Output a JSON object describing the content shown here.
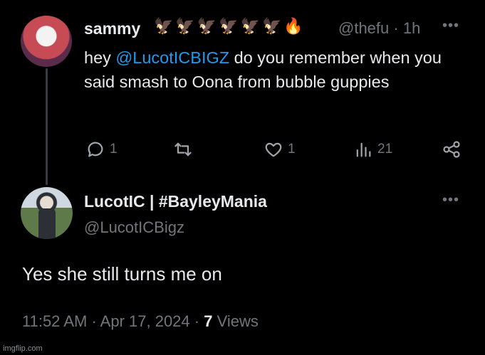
{
  "tweet1": {
    "author_name": "sammy",
    "badge_emojis": "🦅🦅🦅🦅🦅🦅🔥",
    "handle": "@thefu",
    "time": "1h",
    "more_label": "•••",
    "text_before": "hey ",
    "mention": "@LucotICBIGZ",
    "text_after": " do you remember when you said smash to Oona from bubble guppies",
    "reply_count": "1",
    "repost_count": "",
    "like_count": "1",
    "views_count": "21"
  },
  "tweet2": {
    "author_name": "LucotIC | #BayleyMania",
    "handle": "@LucotICBigz",
    "more_label": "•••",
    "text": "Yes she still turns me on",
    "time": "11:52 AM",
    "date": "Apr 17, 2024",
    "views_count": "7",
    "views_label": "Views"
  },
  "icons": {
    "reply": "comment-icon",
    "repost": "repost-icon",
    "like": "heart-icon",
    "views": "analytics-icon",
    "share": "share-icon"
  },
  "watermark": "imgflip.com"
}
